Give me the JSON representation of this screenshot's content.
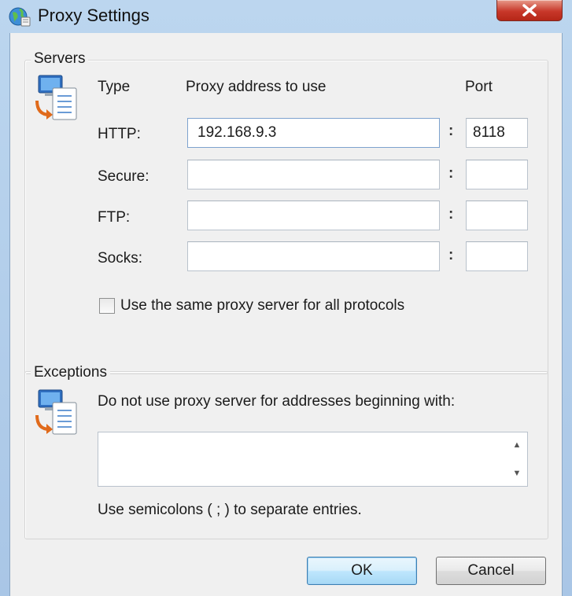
{
  "window": {
    "title": "Proxy Settings",
    "icons": {
      "app": "globe-icon",
      "close": "close-icon"
    }
  },
  "servers": {
    "legend": "Servers",
    "icon": "proxy-server-icon",
    "col_type": "Type",
    "col_address": "Proxy address to use",
    "col_port": "Port",
    "rows": [
      {
        "type": "HTTP:",
        "address": "192.168.9.3",
        "port": "8118"
      },
      {
        "type": "Secure:",
        "address": "",
        "port": ""
      },
      {
        "type": "FTP:",
        "address": "",
        "port": ""
      },
      {
        "type": "Socks:",
        "address": "",
        "port": ""
      }
    ],
    "separator": ":",
    "same_proxy_label": "Use the same proxy server for all protocols",
    "same_proxy_checked": false
  },
  "exceptions": {
    "legend": "Exceptions",
    "icon": "proxy-server-icon",
    "instruction": "Do not use proxy server for addresses beginning with:",
    "value": "",
    "hint": "Use semicolons ( ; ) to separate entries."
  },
  "buttons": {
    "ok": "OK",
    "cancel": "Cancel"
  },
  "colors": {
    "titlebar": "#bcd6ef",
    "dialog_bg": "#f0f0f0",
    "close_red": "#c8382a",
    "default_button": "#bee6fd"
  }
}
